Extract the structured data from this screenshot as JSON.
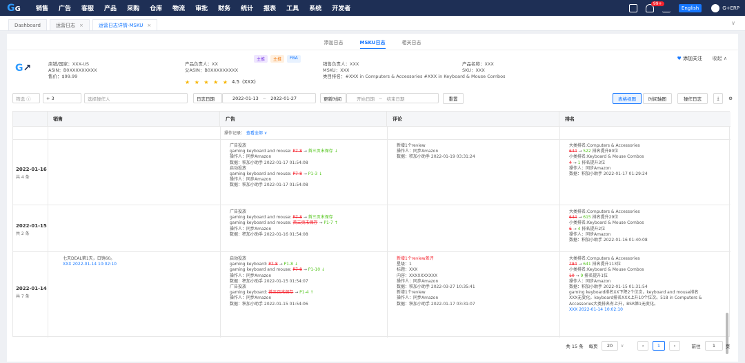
{
  "brand": {
    "logo_text": "G",
    "logo_accent": "G"
  },
  "nav": [
    "销售",
    "广告",
    "客服",
    "产品",
    "采购",
    "仓库",
    "物流",
    "审批",
    "财务",
    "统计",
    "报表",
    "工具",
    "系统",
    "开发者"
  ],
  "topright": {
    "badge": "99+",
    "lang": "English",
    "company": "G+ERP"
  },
  "tabs": [
    {
      "label": "Dashboard"
    },
    {
      "label": "运营日志",
      "close": "×"
    },
    {
      "label": "运营日志详情-MSKU",
      "close": "×"
    }
  ],
  "tabs_more": "∨",
  "subtabs": [
    "添加日志",
    "MSKU日志",
    "相关日志"
  ],
  "product": {
    "tags": [
      "主推",
      "主推",
      "FBA"
    ],
    "shop": "店铺/国家：XXX-US",
    "asin": "ASIN：B0XXXXXXXXX",
    "price": "售价：$99.99",
    "owner": "产品负责人：XX",
    "parent_asin": "父ASIN：B0XXXXXXXXX",
    "rating": "4.5",
    "rating_count": "(XXX)",
    "stars": "★ ★ ★ ★ ★",
    "sales_owner": "销售负责人：XXX",
    "msku": "MSKU：XXX",
    "category": "类目排名：#XXX in Computers & Accessories #XXX in Keyboard & Mouse Combos",
    "product_name": "产品名称：XXX",
    "sku": "SKU：XXX",
    "follow_icon": "♥",
    "follow": "添加关注",
    "collapse": "收起 ∧"
  },
  "filters": {
    "group_label": "筛选 ⓘ",
    "group_value": "+ 3",
    "person_placeholder": "选择操作人",
    "date_type": "日志日期",
    "date_from": "2022-01-13",
    "date_sep": "~",
    "date_to": "2022-01-27",
    "update_label": "更新时间",
    "update_from": "开始日期",
    "update_sep": "~",
    "update_to": "结束日期",
    "reset": "重置",
    "view_table": "表格视图",
    "view_timeline": "时间轴图",
    "oplog": "操作日志",
    "download_icon": "⤓",
    "gear_icon": "⚙"
  },
  "table": {
    "headers": [
      "",
      "销售",
      "广告",
      "评论",
      "排名"
    ],
    "filter_label": "操作记录：",
    "filter_link": "查看全部 ∨",
    "rows": [
      {
        "date": "2022-01-16",
        "count": "共 4 条",
        "ad": [
          [
            "广告投放"
          ],
          [
            "gaming keyboard and mouse: ",
            {
              "r": "P7-8"
            },
            " → ",
            {
              "g": "首三页末保存 ↓"
            }
          ],
          [
            "操作人：同步Amazon"
          ],
          [
            "数据：积加小助手 2022-01-17 01:54:08"
          ],
          [
            "启动投放"
          ],
          [
            "gaming keyboard and mouse: ",
            {
              "r": "P7-8"
            },
            " → ",
            {
              "g": "P1-3 ↓"
            }
          ],
          [
            "操作人：同步Amazon"
          ],
          [
            "数据：积加小助手 2022-01-17 01:54:08"
          ]
        ],
        "review": [
          [
            "新增1个review"
          ],
          [
            "操作人：同步Amazon"
          ],
          [
            "数据：积加小助手 2022-01-19 03:31:24"
          ]
        ],
        "rank": [
          [
            "大类排名:Computers & Accessories"
          ],
          [
            {
              "r": "644"
            },
            " → ",
            {
              "g": "522"
            },
            " 排名提升80位"
          ],
          [
            "小类排名:Keyboard & Mouse Combos"
          ],
          [
            {
              "r": "4"
            },
            " → ",
            {
              "g": "1"
            },
            " 排名提升3位"
          ],
          [
            "操作人：同步Amazon"
          ],
          [
            "数据：积加小助手 2022-01-17 01:29:24"
          ]
        ]
      },
      {
        "date": "2022-01-15",
        "count": "共 2 条",
        "ad": [
          [
            "广告投放"
          ],
          [
            "gaming keyboard and mouse: ",
            {
              "r": "P7-8"
            },
            " → ",
            {
              "g": "首三页末保存"
            }
          ],
          [
            "gaming keyboard and mouse: ",
            {
              "r": "首三页末保存"
            },
            " → ",
            {
              "g": "P1-7 ↑"
            }
          ],
          [
            "操作人：同步Amazon"
          ],
          [
            "数据：积加小助手 2022-01-16 01:54:08"
          ]
        ],
        "review": [],
        "rank": [
          [
            "大类排名:Computers & Accessories"
          ],
          [
            {
              "r": "644"
            },
            " → ",
            {
              "g": "615"
            },
            " 排名提升29位"
          ],
          [
            "小类排名:Keyboard & Mouse Combos"
          ],
          [
            {
              "r": "6"
            },
            " → ",
            {
              "g": "4"
            },
            " 排名提升2位"
          ],
          [
            "操作人：同步Amazon"
          ],
          [
            "数据：积加小助手 2022-01-16 01:40:08"
          ]
        ]
      },
      {
        "date": "2022-01-14",
        "count": "共 7 条",
        "sales": [
          [
            "七天DEAL第1天，日销60。"
          ],
          [
            {
              "b": "XXX 2022-01-14 10:02:10"
            }
          ]
        ],
        "ad": [
          [
            "启动投放"
          ],
          [
            "gaming keyboard: ",
            {
              "r": "P7-8"
            },
            " → ",
            {
              "g": "P1-8 ↓"
            }
          ],
          [
            "gaming keyboard and mouse: ",
            {
              "r": "P7-8"
            },
            " → ",
            {
              "g": "P1-10 ↓"
            }
          ],
          [
            "操作人：同步Amazon"
          ],
          [
            "数据：积加小助手 2022-01-15 01:54:07"
          ],
          [
            "广告投放"
          ],
          [
            "gaming keyboard: ",
            {
              "r": "首三页末保存"
            },
            " → ",
            {
              "g": "P1-4 ↑"
            }
          ],
          [
            "操作人：同步Amazon"
          ],
          [
            "数据：积加小助手 2022-01-15 01:54:06"
          ]
        ],
        "review": [
          [
            {
              "rr": "新增1个review差评"
            }
          ],
          [
            "星级：1"
          ],
          [
            "标题：XXX"
          ],
          [
            "内容：XXXXXXXXXX"
          ],
          [
            "操作人：同步Amazon"
          ],
          [
            "数据：积加小助手 2022-03-27 10:35:41"
          ],
          [
            "新增1个review"
          ],
          [
            "操作人：同步Amazon"
          ],
          [
            "数据：积加小助手 2022-01-17 03:31:07"
          ]
        ],
        "rank": [
          [
            "大类排名:Computers & Accessories"
          ],
          [
            {
              "r": "784"
            },
            " → ",
            {
              "g": "641"
            },
            " 排名提升113位"
          ],
          [
            "小类排名:Keyboard & Mouse Combos"
          ],
          [
            {
              "r": "10"
            },
            " → ",
            {
              "g": "9"
            },
            " 排名提升1位"
          ],
          [
            "操作人：同步Amazon"
          ],
          [
            "数据：积加小助手 2022-01-15 01:31:54"
          ],
          [
            "gaming keyboard排名XX下降2个位次，keyboard and mouse排名"
          ],
          [
            "XXX无变化。keyboard排名XXX上升10个位次。518 in Computers &"
          ],
          [
            "Accessories大类排名有上升，BSR第1无变化。"
          ],
          [
            {
              "b": "XXX 2022-01-14 10:02:10"
            }
          ]
        ]
      }
    ]
  },
  "pager": {
    "total": "共 15 条",
    "per_page_label": "每页",
    "per_page": "20",
    "prev": "‹",
    "page": "1",
    "next": "›",
    "goto": "前往",
    "goto_page": "1",
    "page_unit": "页"
  }
}
